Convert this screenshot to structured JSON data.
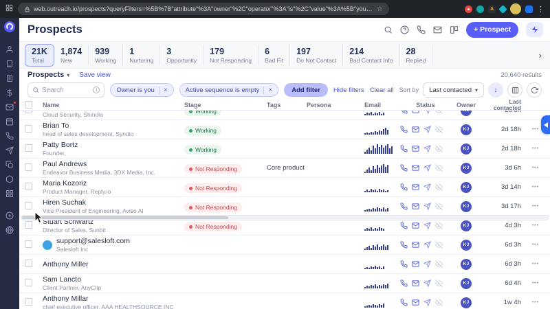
{
  "browser": {
    "url": "web.outreach.io/prospects?queryFilters=%5B%7B\"attribute\"%3A\"owner\"%2C\"operator\"%3A\"is\"%2C\"value\"%3A%5B\"you\"%5D%7D%2C%7B\"attribute\"%3A\"active..."
  },
  "header": {
    "title": "Prospects",
    "new_prospect_label": "+ Prospect"
  },
  "stats": [
    {
      "value": "21K",
      "label": "Total"
    },
    {
      "value": "1,874",
      "label": "New"
    },
    {
      "value": "939",
      "label": "Working"
    },
    {
      "value": "1",
      "label": "Nurturing"
    },
    {
      "value": "3",
      "label": "Opportunity"
    },
    {
      "value": "179",
      "label": "Not Responding"
    },
    {
      "value": "6",
      "label": "Bad Fit"
    },
    {
      "value": "197",
      "label": "Do Not Contact"
    },
    {
      "value": "214",
      "label": "Bad Contact Info"
    },
    {
      "value": "28",
      "label": "Replied"
    }
  ],
  "viewbar": {
    "view_name": "Prospects",
    "save_view_label": "Save view",
    "results_count": "20,640 results"
  },
  "filters": {
    "search_placeholder": "Search",
    "chips": [
      "Owner is you",
      "Active sequence is empty"
    ],
    "add_filter_label": "Add filter",
    "hide_filters_label": "Hide filters",
    "clear_all_label": "Clear all",
    "sort_label": "Sort by",
    "sort_value": "Last contacted"
  },
  "table": {
    "columns": [
      "Name",
      "Stage",
      "Tags",
      "Persona",
      "Email",
      "Status",
      "Owner",
      "Last contacted"
    ],
    "rows": [
      {
        "name": "",
        "subtitle": "Cloud Security, Shinola",
        "stage": "Working",
        "tags": "",
        "activity": [
          2,
          4,
          3,
          5,
          2,
          4,
          3,
          5,
          2,
          4
        ],
        "last": "2d 8h",
        "owner": "KJ"
      },
      {
        "name": "Brian To",
        "subtitle": "head of sales development, Syndio",
        "stage": "Working",
        "tags": "",
        "activity": [
          2,
          3,
          2,
          4,
          3,
          5,
          4,
          6,
          5,
          8,
          10,
          7
        ],
        "last": "2d 18h",
        "owner": "KJ"
      },
      {
        "name": "Patty Bortz",
        "subtitle": "Founder,",
        "stage": "Working",
        "tags": "",
        "activity": [
          3,
          6,
          9,
          5,
          12,
          8,
          14,
          10,
          13,
          9,
          12,
          14,
          8,
          11
        ],
        "last": "2d 18h",
        "owner": "KJ"
      },
      {
        "name": "Paul Andrews",
        "subtitle": "Endeavor Business Media, 3DX Media, Inc.",
        "stage": "Not Responding",
        "tags": "Core product ca...",
        "activity": [
          2,
          5,
          8,
          4,
          10,
          6,
          12,
          8,
          11,
          13,
          9,
          12
        ],
        "last": "3d 6h",
        "owner": "KJ"
      },
      {
        "name": "Maria Kozoriz",
        "subtitle": "Product Manager, Reply.io",
        "stage": "Not Responding",
        "tags": "",
        "activity": [
          2,
          4,
          2,
          5,
          3,
          4,
          2,
          5,
          3,
          4,
          2,
          3
        ],
        "last": "3d 14h",
        "owner": "KJ"
      },
      {
        "name": "Hiren Suchak",
        "subtitle": "Vice President of Engineering, Aviso AI",
        "stage": "Not Responding",
        "tags": "",
        "activity": [
          2,
          3,
          4,
          3,
          5,
          4,
          6,
          5,
          4,
          6,
          3,
          5
        ],
        "last": "3d 17h",
        "owner": "KJ"
      },
      {
        "name": "Stuart Schwartz",
        "subtitle": "Director of Sales, Sunbit",
        "stage": "Not Responding",
        "tags": "",
        "activity": [
          2,
          4,
          3,
          5,
          2,
          4,
          3,
          5,
          4,
          3
        ],
        "last": "4d 3h",
        "owner": "KJ"
      },
      {
        "name": "support@salesloft.com",
        "subtitle": "Salesloft Inc",
        "stage": "",
        "tags": "",
        "avatar": true,
        "activity": [
          2,
          4,
          6,
          3,
          7,
          5,
          8,
          4,
          6,
          8,
          5,
          7
        ],
        "last": "6d 3h",
        "owner": "KJ"
      },
      {
        "name": "Anthony Miller",
        "subtitle": "",
        "stage": "",
        "tags": "",
        "activity": [
          2,
          3,
          2,
          4,
          3,
          5,
          3,
          4,
          2,
          4
        ],
        "last": "6d 3h",
        "owner": "KJ"
      },
      {
        "name": "Sam Lancto",
        "subtitle": "Client Partner, AnyClip",
        "stage": "",
        "tags": "",
        "activity": [
          2,
          4,
          3,
          5,
          4,
          6,
          3,
          5,
          4,
          6,
          5,
          7
        ],
        "last": "6d 4h",
        "owner": "KJ"
      },
      {
        "name": "Anthony Millar",
        "subtitle": "chief executive officer, AAA HEALTHSOURCE INC",
        "stage": "",
        "tags": "",
        "activity": [
          2,
          3,
          4,
          3,
          5,
          4,
          3,
          5,
          4,
          6
        ],
        "last": "1w 4h",
        "owner": "KJ"
      }
    ]
  },
  "icons": {
    "close": "×",
    "more": "•••",
    "caret_down": "▾",
    "chevron_right": "›",
    "sort_arrow": "↓",
    "info": "i",
    "menu_dots": "⋮",
    "star": "☆"
  }
}
